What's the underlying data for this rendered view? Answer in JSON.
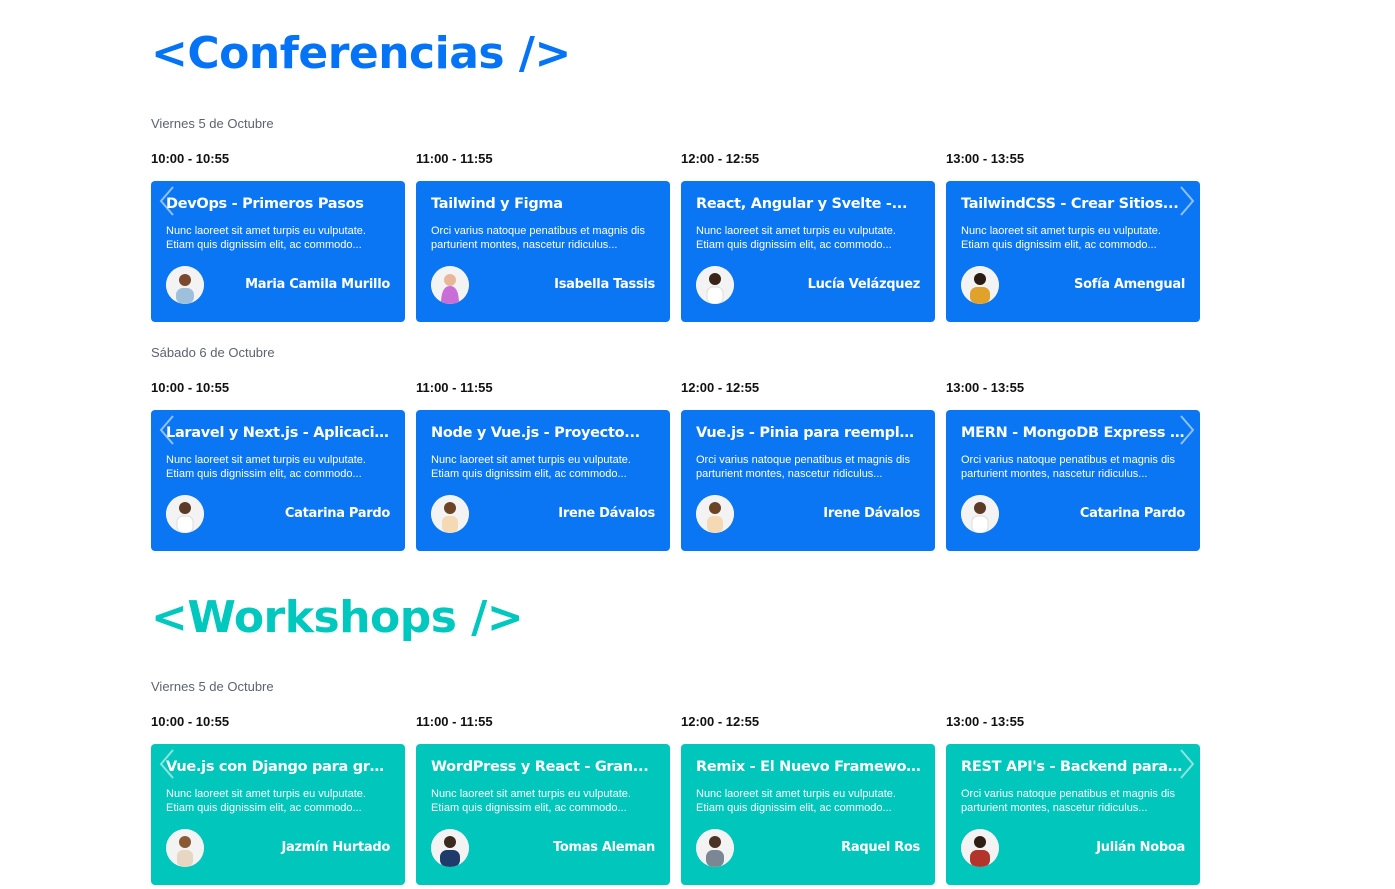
{
  "conferencias": {
    "title": "<Conferencias />",
    "days": [
      {
        "label": "Viernes 5 de Octubre",
        "sessions": [
          {
            "time": "10:00 - 10:55",
            "title": "DevOps - Primeros Pasos",
            "desc": "Nunc laoreet sit amet turpis eu vulputate. Etiam quis dignissim elit, ac commodo...",
            "speaker": "Maria Camila Murillo"
          },
          {
            "time": "11:00 - 11:55",
            "title": "Tailwind y Figma",
            "desc": "Orci varius natoque penatibus et magnis dis parturient montes, nascetur ridiculus...",
            "speaker": "Isabella Tassis"
          },
          {
            "time": "12:00 - 12:55",
            "title": "React, Angular y Svelte -...",
            "desc": "Nunc laoreet sit amet turpis eu vulputate. Etiam quis dignissim elit, ac commodo...",
            "speaker": "Lucía Velázquez"
          },
          {
            "time": "13:00 - 13:55",
            "title": "TailwindCSS - Crear Sitios...",
            "desc": "Nunc laoreet sit amet turpis eu vulputate. Etiam quis dignissim elit, ac commodo...",
            "speaker": "Sofía Amengual"
          }
        ]
      },
      {
        "label": "Sábado 6 de Octubre",
        "sessions": [
          {
            "time": "10:00 - 10:55",
            "title": "Laravel y Next.js - Aplicacione...",
            "desc": "Nunc laoreet sit amet turpis eu vulputate. Etiam quis dignissim elit, ac commodo...",
            "speaker": "Catarina Pardo"
          },
          {
            "time": "11:00 - 11:55",
            "title": "Node y Vue.js - Proyecto...",
            "desc": "Nunc laoreet sit amet turpis eu vulputate. Etiam quis dignissim elit, ac commodo...",
            "speaker": "Irene Dávalos"
          },
          {
            "time": "12:00 - 12:55",
            "title": "Vue.js - Pinia para reemplazar...",
            "desc": "Orci varius natoque penatibus et magnis dis parturient montes, nascetur ridiculus...",
            "speaker": "Irene Dávalos"
          },
          {
            "time": "13:00 - 13:55",
            "title": "MERN - MongoDB Express Rea...",
            "desc": "Orci varius natoque penatibus et magnis dis parturient montes, nascetur ridiculus...",
            "speaker": "Catarina Pardo"
          }
        ]
      }
    ]
  },
  "workshops": {
    "title": "<Workshops />",
    "days": [
      {
        "label": "Viernes 5 de Octubre",
        "sessions": [
          {
            "time": "10:00 - 10:55",
            "title": "Vue.js con Django para gran...",
            "desc": "Nunc laoreet sit amet turpis eu vulputate. Etiam quis dignissim elit, ac commodo...",
            "speaker": "Jazmín Hurtado"
          },
          {
            "time": "11:00 - 11:55",
            "title": "WordPress y React - Gran...",
            "desc": "Nunc laoreet sit amet turpis eu vulputate. Etiam quis dignissim elit, ac commodo...",
            "speaker": "Tomas Aleman"
          },
          {
            "time": "12:00 - 12:55",
            "title": "Remix - El Nuevo Framework d...",
            "desc": "Nunc laoreet sit amet turpis eu vulputate. Etiam quis dignissim elit, ac commodo...",
            "speaker": "Raquel Ros"
          },
          {
            "time": "13:00 - 13:55",
            "title": "REST API's - Backend para We...",
            "desc": "Orci varius natoque penatibus et magnis dis parturient montes, nascetur ridiculus...",
            "speaker": "Julián Noboa"
          }
        ]
      }
    ]
  },
  "icons": {
    "prev": "chevron-left-icon",
    "next": "chevron-right-icon",
    "avatar": "speaker-photo"
  },
  "colors": {
    "conferencias": "#0a76f3",
    "workshops": "#00c6bc"
  }
}
